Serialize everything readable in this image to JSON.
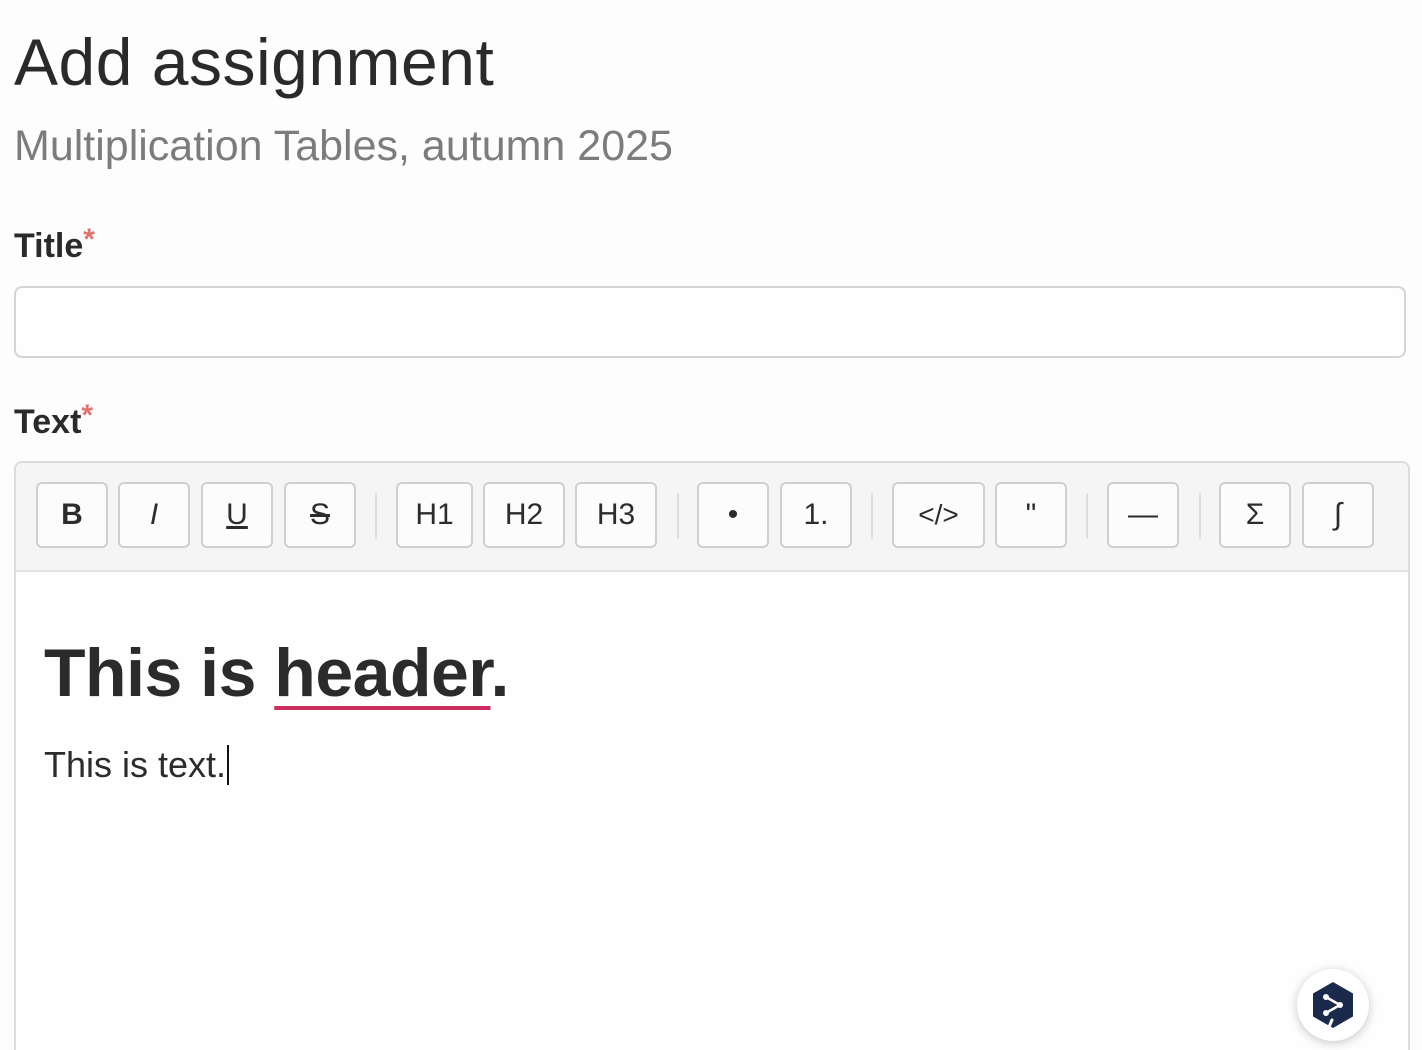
{
  "page": {
    "title": "Add assignment",
    "subtitle": "Multiplication Tables, autumn 2025"
  },
  "form": {
    "title_label": "Title",
    "title_value": "",
    "text_label": "Text",
    "required_marker": "*"
  },
  "toolbar": {
    "buttons": [
      {
        "label": "B",
        "icon": "bold-icon"
      },
      {
        "label": "I",
        "icon": "italic-icon"
      },
      {
        "label": "U",
        "icon": "underline-icon"
      },
      {
        "label": "S",
        "icon": "strikethrough-icon"
      },
      {
        "label": "H1",
        "icon": "heading1-icon"
      },
      {
        "label": "H2",
        "icon": "heading2-icon"
      },
      {
        "label": "H3",
        "icon": "heading3-icon"
      },
      {
        "label": "•",
        "icon": "bullet-list-icon"
      },
      {
        "label": "1.",
        "icon": "numbered-list-icon"
      },
      {
        "label": "</>",
        "icon": "code-icon"
      },
      {
        "label": "\"",
        "icon": "quote-icon"
      },
      {
        "label": "—",
        "icon": "horizontal-rule-icon"
      },
      {
        "label": "Σ",
        "icon": "sum-icon"
      },
      {
        "label": "∫",
        "icon": "integral-icon"
      }
    ]
  },
  "editor": {
    "heading_prefix": "This is ",
    "heading_misspelled": "header",
    "heading_suffix": ".",
    "paragraph": "This is text."
  },
  "colors": {
    "required": "#e0736f",
    "spellcheck": "#cc2e5f",
    "fab_icon": "#1b2a4a"
  },
  "fab": {
    "icon": "translate-assistant-icon"
  }
}
